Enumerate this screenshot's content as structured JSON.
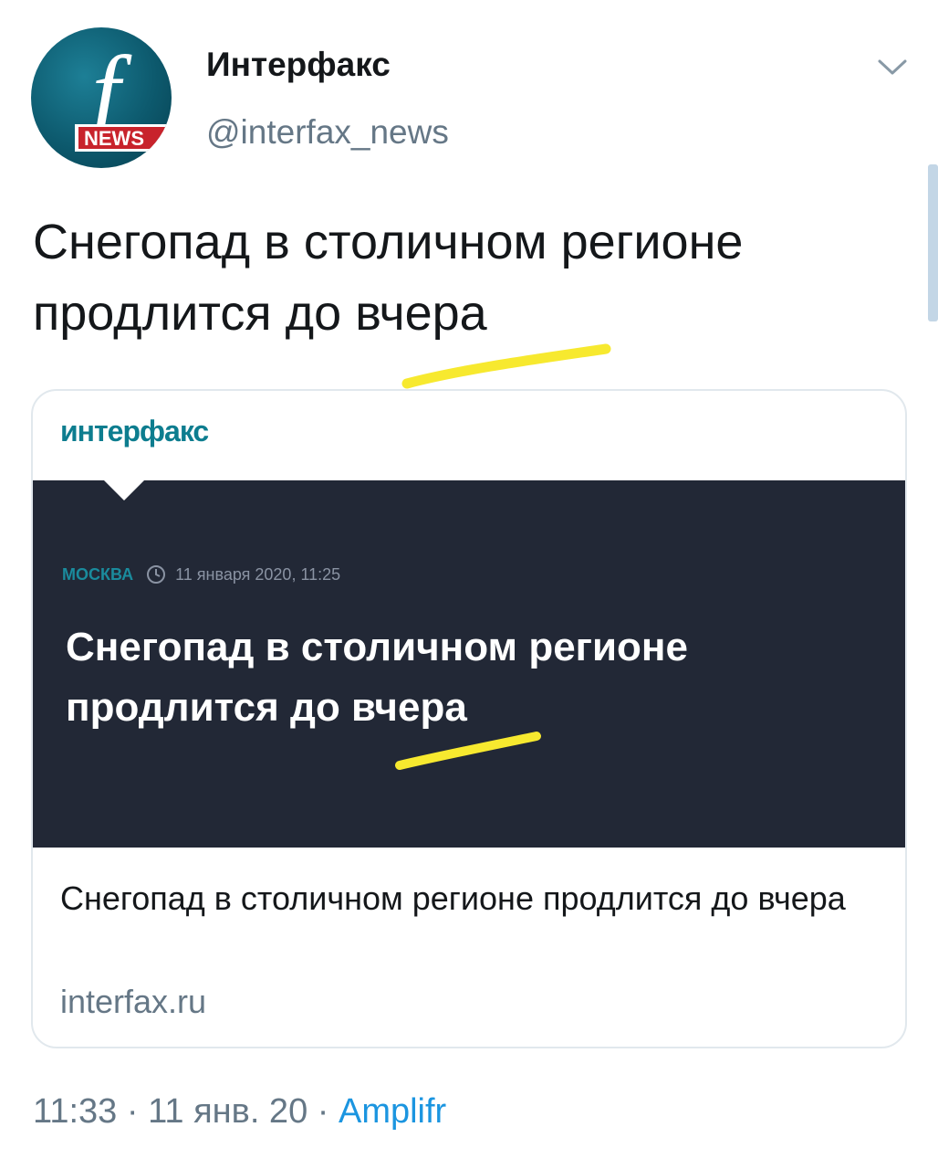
{
  "author": {
    "display_name": "Интерфакс",
    "handle": "@interfax_news",
    "avatar": {
      "icon": "interfax-news-logo-icon",
      "letter": "f",
      "badge": "NEWS"
    }
  },
  "tweet": {
    "text": "Снегопад в столичном регионе продлится до вчера"
  },
  "card": {
    "logo_text": "интерфакс",
    "image": {
      "region": "МОСКВА",
      "datetime": "11 января 2020, 11:25",
      "headline": "Снегопад в столичном регионе продлится до вчера"
    },
    "title": "Снегопад в столичном регионе продлится до вчера",
    "domain": "interfax.ru"
  },
  "meta": {
    "time": "11:33",
    "separator": "·",
    "date": "11 янв. 20",
    "source": "Amplifr"
  },
  "colors": {
    "highlight": "#f7e92f",
    "link": "#1b95e0",
    "secondary_text": "#657786",
    "image_bg": "#222836",
    "brand_teal": "#0d7d8f"
  }
}
